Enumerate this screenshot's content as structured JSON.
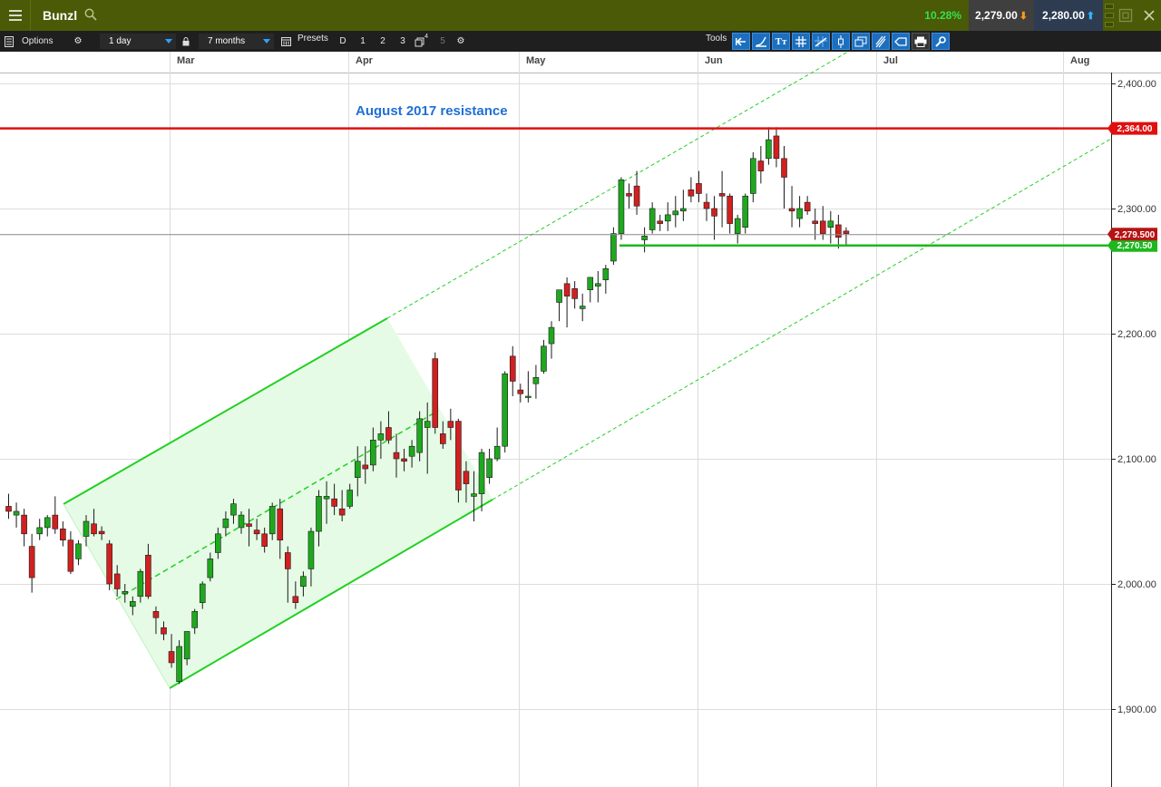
{
  "header": {
    "instrument": "Bunzl",
    "change": "10.28%",
    "sell_price": "2,279.00",
    "buy_price": "2,280.00"
  },
  "toolbar": {
    "options_label": "Options",
    "interval": "1 day",
    "range": "7 months",
    "presets_label": "Presets",
    "preset_buttons": [
      "D",
      "1",
      "2",
      "3",
      "4",
      "5"
    ],
    "tools_label": "Tools"
  },
  "icons": [
    "menu-icon",
    "search-icon",
    "down-arrow-icon",
    "up-arrow-icon",
    "popout-icon",
    "close-icon",
    "layout-icon",
    "gear-icon",
    "lock-icon",
    "calendar-icon",
    "copy-icon",
    "back-arrow-icon",
    "curve-icon",
    "text-tool-icon",
    "grid-icon",
    "trendline-icon",
    "candle-icon",
    "windows-icon",
    "fork-icon",
    "tag-icon",
    "print-icon",
    "settings-tool-icon"
  ],
  "colors": {
    "header_bg": "#4a5a06",
    "bull": "#1fa81f",
    "bear": "#d02020",
    "resistance": "#e01010",
    "support": "#1db81d",
    "annotation": "#1e6fd6"
  },
  "chart": {
    "annotation": "August 2017 resistance",
    "resistance_label": "2,364.00",
    "current_label": "2,279.500",
    "support_label": "2,270.50"
  },
  "chart_data": {
    "type": "candlestick",
    "x_labels": [
      "Mar",
      "Apr",
      "May",
      "Jun",
      "Jul",
      "Aug"
    ],
    "y_ticks": [
      "2,400.00",
      "2,300.00",
      "2,200.00",
      "2,100.00",
      "2,000.00",
      "1,900.00"
    ],
    "ylim": [
      1860,
      2415
    ],
    "resistance": 2364,
    "support": 2270.5,
    "last": 2279.5,
    "candles": [
      [
        2062,
        2072,
        2052,
        2058
      ],
      [
        2055,
        2065,
        2045,
        2058
      ],
      [
        2055,
        2060,
        2030,
        2040
      ],
      [
        2030,
        2040,
        1993,
        2005
      ],
      [
        2040,
        2052,
        2035,
        2045
      ],
      [
        2045,
        2055,
        2038,
        2053
      ],
      [
        2055,
        2070,
        2040,
        2044
      ],
      [
        2044,
        2050,
        2030,
        2035
      ],
      [
        2035,
        2042,
        2008,
        2010
      ],
      [
        2020,
        2035,
        2015,
        2032
      ],
      [
        2038,
        2055,
        2030,
        2050
      ],
      [
        2048,
        2060,
        2038,
        2040
      ],
      [
        2042,
        2046,
        2035,
        2040
      ],
      [
        2032,
        2035,
        1995,
        2000
      ],
      [
        2008,
        2015,
        1990,
        1996
      ],
      [
        1992,
        2000,
        1985,
        1994
      ],
      [
        1982,
        1990,
        1975,
        1986
      ],
      [
        1990,
        2012,
        1985,
        2010
      ],
      [
        2023,
        2032,
        1988,
        1990
      ],
      [
        1978,
        1982,
        1960,
        1973
      ],
      [
        1965,
        1970,
        1955,
        1960
      ],
      [
        1946,
        1960,
        1933,
        1937
      ],
      [
        1922,
        1955,
        1920,
        1950
      ],
      [
        1940,
        1962,
        1935,
        1962
      ],
      [
        1965,
        1980,
        1960,
        1978
      ],
      [
        1985,
        2002,
        1980,
        2000
      ],
      [
        2005,
        2025,
        2002,
        2020
      ],
      [
        2025,
        2045,
        2020,
        2040
      ],
      [
        2045,
        2058,
        2038,
        2052
      ],
      [
        2055,
        2068,
        2048,
        2064
      ],
      [
        2045,
        2058,
        2040,
        2055
      ],
      [
        2048,
        2060,
        2030,
        2046
      ],
      [
        2043,
        2052,
        2035,
        2040
      ],
      [
        2040,
        2045,
        2025,
        2030
      ],
      [
        2040,
        2065,
        2035,
        2062
      ],
      [
        2060,
        2068,
        2020,
        2035
      ],
      [
        2025,
        2030,
        1985,
        2012
      ],
      [
        1990,
        2002,
        1980,
        1985
      ],
      [
        1998,
        2010,
        1990,
        2006
      ],
      [
        2012,
        2045,
        1998,
        2042
      ],
      [
        2042,
        2075,
        2030,
        2070
      ],
      [
        2068,
        2082,
        2048,
        2070
      ],
      [
        2068,
        2080,
        2055,
        2062
      ],
      [
        2060,
        2075,
        2050,
        2055
      ],
      [
        2062,
        2080,
        2060,
        2075
      ],
      [
        2085,
        2110,
        2070,
        2098
      ],
      [
        2095,
        2110,
        2080,
        2092
      ],
      [
        2095,
        2125,
        2090,
        2115
      ],
      [
        2115,
        2130,
        2100,
        2120
      ],
      [
        2125,
        2138,
        2112,
        2115
      ],
      [
        2105,
        2120,
        2085,
        2100
      ],
      [
        2100,
        2108,
        2090,
        2098
      ],
      [
        2102,
        2115,
        2093,
        2110
      ],
      [
        2105,
        2138,
        2098,
        2132
      ],
      [
        2125,
        2145,
        2088,
        2130
      ],
      [
        2180,
        2185,
        2120,
        2125
      ],
      [
        2120,
        2130,
        2108,
        2112
      ],
      [
        2130,
        2140,
        2115,
        2125
      ],
      [
        2130,
        2132,
        2065,
        2075
      ],
      [
        2090,
        2098,
        2065,
        2080
      ],
      [
        2070,
        2090,
        2050,
        2072
      ],
      [
        2072,
        2108,
        2058,
        2105
      ],
      [
        2085,
        2108,
        2080,
        2100
      ],
      [
        2100,
        2125,
        2098,
        2110
      ],
      [
        2110,
        2170,
        2105,
        2168
      ],
      [
        2182,
        2190,
        2150,
        2162
      ],
      [
        2155,
        2160,
        2145,
        2152
      ],
      [
        2150,
        2170,
        2145,
        2150
      ],
      [
        2160,
        2175,
        2148,
        2165
      ],
      [
        2170,
        2195,
        2168,
        2190
      ],
      [
        2192,
        2210,
        2180,
        2205
      ],
      [
        2225,
        2235,
        2210,
        2235
      ],
      [
        2240,
        2245,
        2205,
        2230
      ],
      [
        2236,
        2242,
        2220,
        2228
      ],
      [
        2220,
        2232,
        2210,
        2222
      ],
      [
        2235,
        2245,
        2225,
        2245
      ],
      [
        2238,
        2250,
        2225,
        2240
      ],
      [
        2243,
        2255,
        2232,
        2252
      ],
      [
        2258,
        2285,
        2255,
        2280
      ],
      [
        2280,
        2325,
        2275,
        2323
      ],
      [
        2312,
        2320,
        2300,
        2310
      ],
      [
        2318,
        2330,
        2295,
        2302
      ],
      [
        2275,
        2285,
        2265,
        2278
      ],
      [
        2283,
        2305,
        2280,
        2300
      ],
      [
        2290,
        2295,
        2282,
        2288
      ],
      [
        2290,
        2305,
        2282,
        2295
      ],
      [
        2295,
        2310,
        2285,
        2298
      ],
      [
        2298,
        2315,
        2290,
        2300
      ],
      [
        2315,
        2325,
        2305,
        2310
      ],
      [
        2320,
        2330,
        2305,
        2312
      ],
      [
        2305,
        2312,
        2290,
        2300
      ],
      [
        2300,
        2310,
        2275,
        2294
      ],
      [
        2312,
        2330,
        2285,
        2310
      ],
      [
        2310,
        2312,
        2280,
        2288
      ],
      [
        2280,
        2295,
        2272,
        2292
      ],
      [
        2285,
        2312,
        2280,
        2310
      ],
      [
        2312,
        2345,
        2305,
        2340
      ],
      [
        2338,
        2350,
        2320,
        2330
      ],
      [
        2340,
        2365,
        2335,
        2355
      ],
      [
        2358,
        2365,
        2333,
        2340
      ],
      [
        2340,
        2350,
        2300,
        2325
      ],
      [
        2300,
        2318,
        2285,
        2298
      ],
      [
        2292,
        2310,
        2285,
        2300
      ],
      [
        2305,
        2310,
        2295,
        2298
      ],
      [
        2290,
        2300,
        2275,
        2288
      ],
      [
        2290,
        2302,
        2275,
        2280
      ],
      [
        2285,
        2298,
        2272,
        2290
      ],
      [
        2287,
        2295,
        2268,
        2277
      ],
      [
        2282,
        2285,
        2270,
        2280
      ]
    ]
  }
}
